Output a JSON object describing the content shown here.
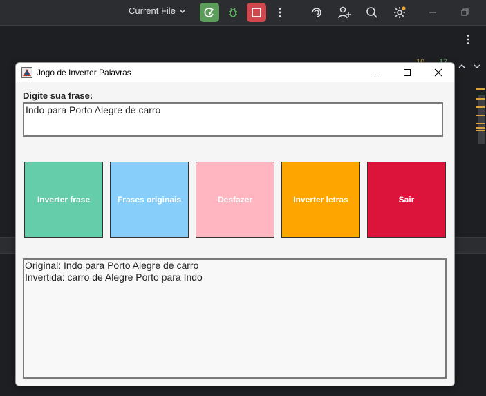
{
  "ide": {
    "run_config_label": "Current File",
    "warning_count": "10",
    "ok_count": "17"
  },
  "window": {
    "title": "Jogo de Inverter Palavras",
    "prompt_label": "Digite sua frase:",
    "input_value": "Indo para Porto Alegre de carro",
    "buttons": [
      {
        "label": "Inverter frase",
        "color": "#66cdaa"
      },
      {
        "label": "Frases originais",
        "color": "#87cefa"
      },
      {
        "label": "Desfazer",
        "color": "#ffb6c1"
      },
      {
        "label": "Inverter letras",
        "color": "#ffa500"
      },
      {
        "label": "Sair",
        "color": "#dc143c"
      }
    ],
    "output_lines": [
      "Original: Indo para Porto Alegre de carro",
      "Invertida: carro de Alegre Porto para Indo"
    ]
  },
  "colors": {
    "ide_bg": "#2b2d30",
    "editor_bg": "#1e1f22",
    "run_green": "#5c9d5c",
    "stop_red": "#d1474e"
  }
}
